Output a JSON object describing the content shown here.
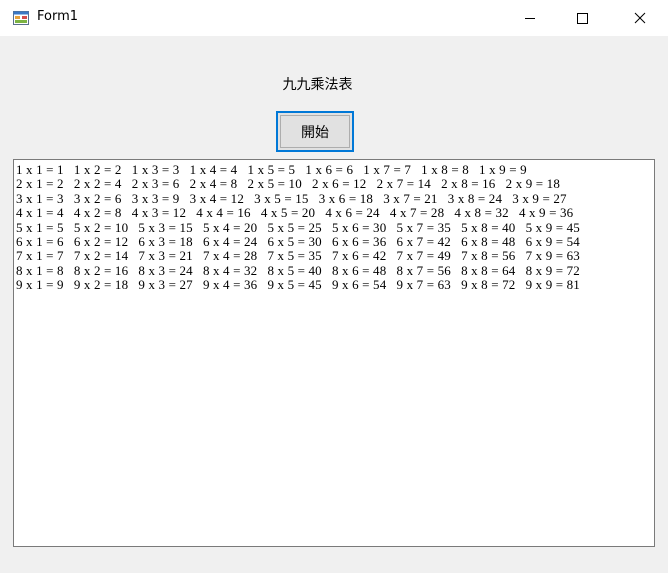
{
  "window": {
    "title": "Form1"
  },
  "icons": {
    "app": "form-app-icon",
    "minimize": "minimize-icon",
    "maximize": "maximize-icon",
    "close": "close-icon"
  },
  "main": {
    "heading": "九九乘法表",
    "start_button_label": "開始",
    "output_lines": [
      "1 x 1 = 1   1 x 2 = 2   1 x 3 = 3   1 x 4 = 4   1 x 5 = 5   1 x 6 = 6   1 x 7 = 7   1 x 8 = 8   1 x 9 = 9",
      "2 x 1 = 2   2 x 2 = 4   2 x 3 = 6   2 x 4 = 8   2 x 5 = 10   2 x 6 = 12   2 x 7 = 14   2 x 8 = 16   2 x 9 = 18",
      "3 x 1 = 3   3 x 2 = 6   3 x 3 = 9   3 x 4 = 12   3 x 5 = 15   3 x 6 = 18   3 x 7 = 21   3 x 8 = 24   3 x 9 = 27",
      "4 x 1 = 4   4 x 2 = 8   4 x 3 = 12   4 x 4 = 16   4 x 5 = 20   4 x 6 = 24   4 x 7 = 28   4 x 8 = 32   4 x 9 = 36",
      "5 x 1 = 5   5 x 2 = 10   5 x 3 = 15   5 x 4 = 20   5 x 5 = 25   5 x 6 = 30   5 x 7 = 35   5 x 8 = 40   5 x 9 = 45",
      "6 x 1 = 6   6 x 2 = 12   6 x 3 = 18   6 x 4 = 24   6 x 5 = 30   6 x 6 = 36   6 x 7 = 42   6 x 8 = 48   6 x 9 = 54",
      "7 x 1 = 7   7 x 2 = 14   7 x 3 = 21   7 x 4 = 28   7 x 5 = 35   7 x 6 = 42   7 x 7 = 49   7 x 8 = 56   7 x 9 = 63",
      "8 x 1 = 8   8 x 2 = 16   8 x 3 = 24   8 x 4 = 32   8 x 5 = 40   8 x 6 = 48   8 x 7 = 56   8 x 8 = 64   8 x 9 = 72",
      "9 x 1 = 9   9 x 2 = 18   9 x 3 = 27   9 x 4 = 36   9 x 5 = 45   9 x 6 = 54   9 x 7 = 63   9 x 8 = 72   9 x 9 = 81"
    ]
  },
  "colors": {
    "title_bar": "#ffffff",
    "form_background": "#f0f0f0",
    "button_focus_border": "#0078d7",
    "button_face": "#e1e1e1",
    "text_box_border": "#7a7a7a"
  }
}
